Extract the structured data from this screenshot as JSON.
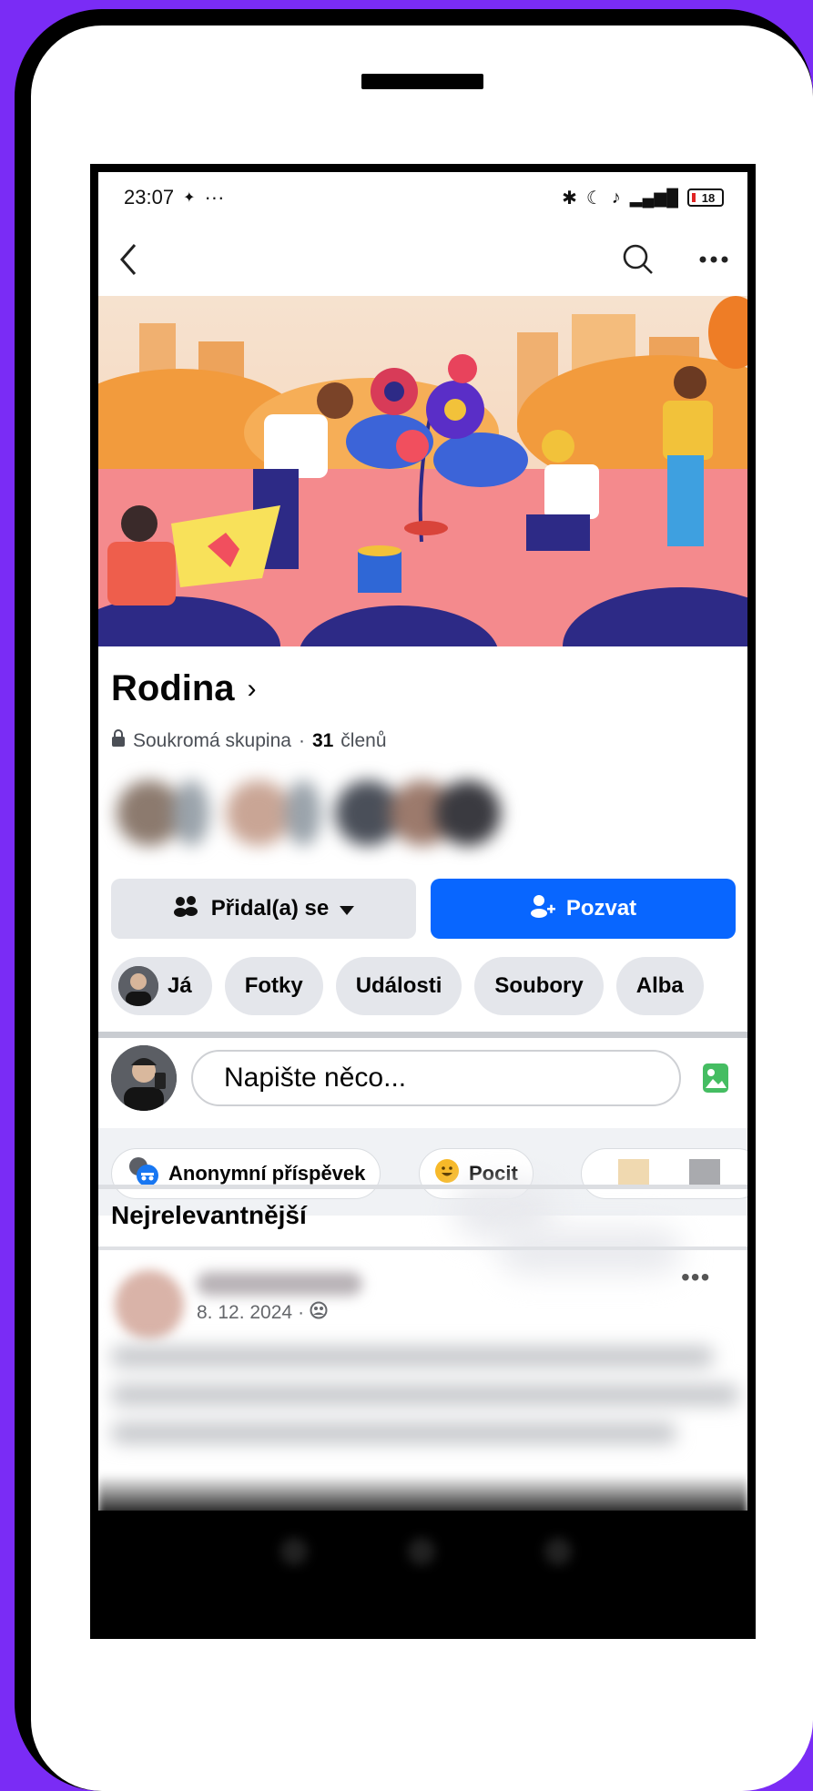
{
  "status": {
    "time": "23:07",
    "dots": "···",
    "battery": "18"
  },
  "group": {
    "name": "Rodina",
    "privacy": "Soukromá skupina",
    "member_count": "31",
    "members_suffix": "členů",
    "separator": "·"
  },
  "actions": {
    "joined_label": "Přidal(a) se",
    "invite_label": "Pozvat"
  },
  "chips": [
    {
      "label": "Já"
    },
    {
      "label": "Fotky"
    },
    {
      "label": "Události"
    },
    {
      "label": "Soubory"
    },
    {
      "label": "Alba"
    }
  ],
  "composer": {
    "placeholder": "Napište něco..."
  },
  "post_options": {
    "anonymous": "Anonymní příspěvek",
    "feeling": "Pocit"
  },
  "feed": {
    "sort_label": "Nejrelevantnější"
  },
  "post": {
    "date": "8. 12. 2024",
    "date_separator": "·"
  },
  "colors": {
    "background": "#7a2cf5",
    "primary": "#0866ff",
    "chip_bg": "#e4e6eb"
  }
}
